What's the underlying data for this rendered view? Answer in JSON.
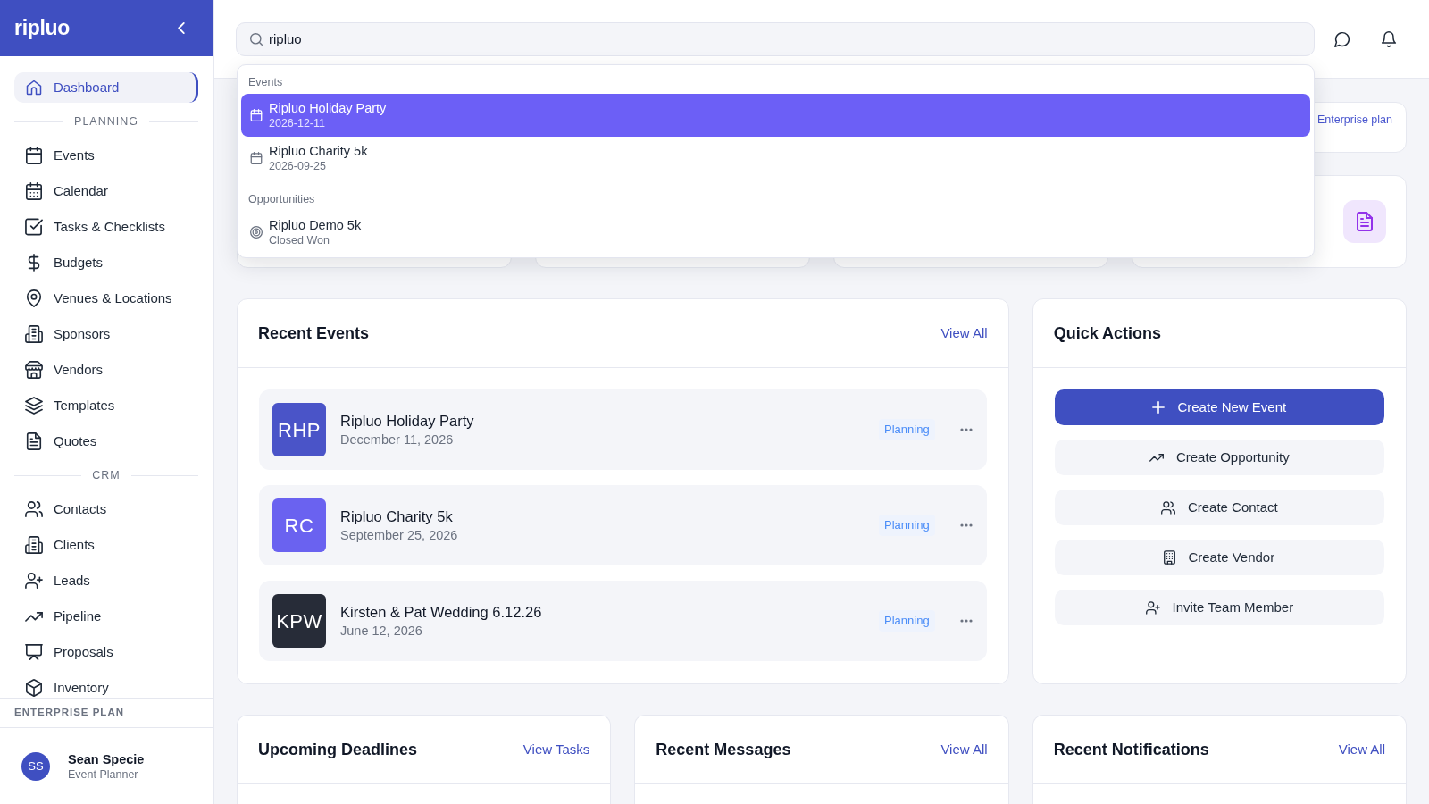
{
  "sidebar": {
    "logo": "ripluo",
    "items": [
      {
        "label": "Dashboard",
        "selected": true
      }
    ],
    "sections": [
      {
        "heading": "PLANNING",
        "items": [
          {
            "label": "Events",
            "selected": false
          },
          {
            "label": "Calendar",
            "selected": false
          },
          {
            "label": "Tasks & Checklists",
            "selected": false
          },
          {
            "label": "Budgets",
            "selected": false
          },
          {
            "label": "Venues & Locations",
            "selected": false
          },
          {
            "label": "Sponsors",
            "selected": false
          },
          {
            "label": "Vendors",
            "selected": false
          },
          {
            "label": "Templates",
            "selected": false
          },
          {
            "label": "Quotes",
            "selected": false
          }
        ]
      },
      {
        "heading": "CRM",
        "items": [
          {
            "label": "Contacts",
            "selected": false
          },
          {
            "label": "Clients",
            "selected": false
          },
          {
            "label": "Leads",
            "selected": false
          },
          {
            "label": "Pipeline",
            "selected": false
          },
          {
            "label": "Proposals",
            "selected": false
          },
          {
            "label": "Inventory",
            "selected": false
          }
        ]
      }
    ],
    "plan": "ENTERPRISE PLAN",
    "user": {
      "initials": "SS",
      "name": "Sean Specie",
      "role": "Event Planner"
    }
  },
  "search": {
    "value": "ripluo"
  },
  "search_results": [
    {
      "heading": "Events",
      "kind": "event",
      "items": [
        {
          "title": "Ripluo Holiday Party",
          "subtitle": "2026-12-11",
          "selected": true
        },
        {
          "title": "Ripluo Charity 5k",
          "subtitle": "2026-09-25",
          "selected": false
        }
      ]
    },
    {
      "heading": "Opportunities",
      "kind": "opportunity",
      "items": [
        {
          "title": "Ripluo Demo 5k",
          "subtitle": "Closed Won",
          "selected": false
        }
      ]
    }
  ],
  "banner": {
    "plan_link": "Enterprise plan"
  },
  "recent_events": {
    "title": "Recent Events",
    "link": "View All",
    "events": [
      {
        "initials": "RHP",
        "name": "Ripluo Holiday Party",
        "date": "December 11, 2026",
        "status": "Planning",
        "color": "#4a54c8"
      },
      {
        "initials": "RC",
        "name": "Ripluo Charity 5k",
        "date": "September 25, 2026",
        "status": "Planning",
        "color": "#6a62f0"
      },
      {
        "initials": "KPW",
        "name": "Kirsten & Pat Wedding 6.12.26",
        "date": "June 12, 2026",
        "status": "Planning",
        "color": "#272c38"
      }
    ]
  },
  "quick_actions": {
    "title": "Quick Actions",
    "actions": [
      {
        "label": "Create New Event",
        "kind": "primary"
      },
      {
        "label": "Create Opportunity",
        "kind": "secondary"
      },
      {
        "label": "Create Contact",
        "kind": "secondary"
      },
      {
        "label": "Create Vendor",
        "kind": "secondary"
      },
      {
        "label": "Invite Team Member",
        "kind": "secondary"
      }
    ]
  },
  "panels": [
    {
      "title": "Upcoming Deadlines",
      "link": "View Tasks"
    },
    {
      "title": "Recent Messages",
      "link": "View All"
    },
    {
      "title": "Recent Notifications",
      "link": "View All"
    }
  ]
}
